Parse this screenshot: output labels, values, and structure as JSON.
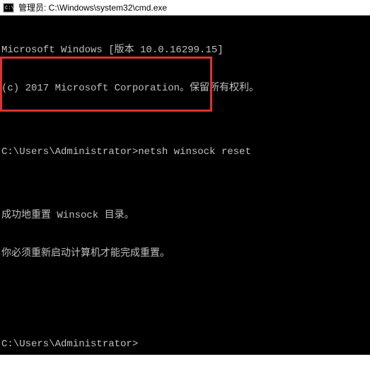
{
  "titlebar": {
    "icon_label": "cmd-icon",
    "title": "管理员: C:\\Windows\\system32\\cmd.exe"
  },
  "terminal": {
    "lines": {
      "l0": "Microsoft Windows [版本 10.0.16299.15]",
      "l1": "(c) 2017 Microsoft Corporation。保留所有权利。",
      "l2": "",
      "l3_prompt": "C:\\Users\\Administrator>",
      "l3_cmd": "netsh winsock reset",
      "l4": "",
      "l5": "成功地重置 Winsock 目录。",
      "l6": "你必须重新启动计算机才能完成重置。",
      "l7": "",
      "l8": "",
      "l9_prompt": "C:\\Users\\Administrator>"
    }
  }
}
